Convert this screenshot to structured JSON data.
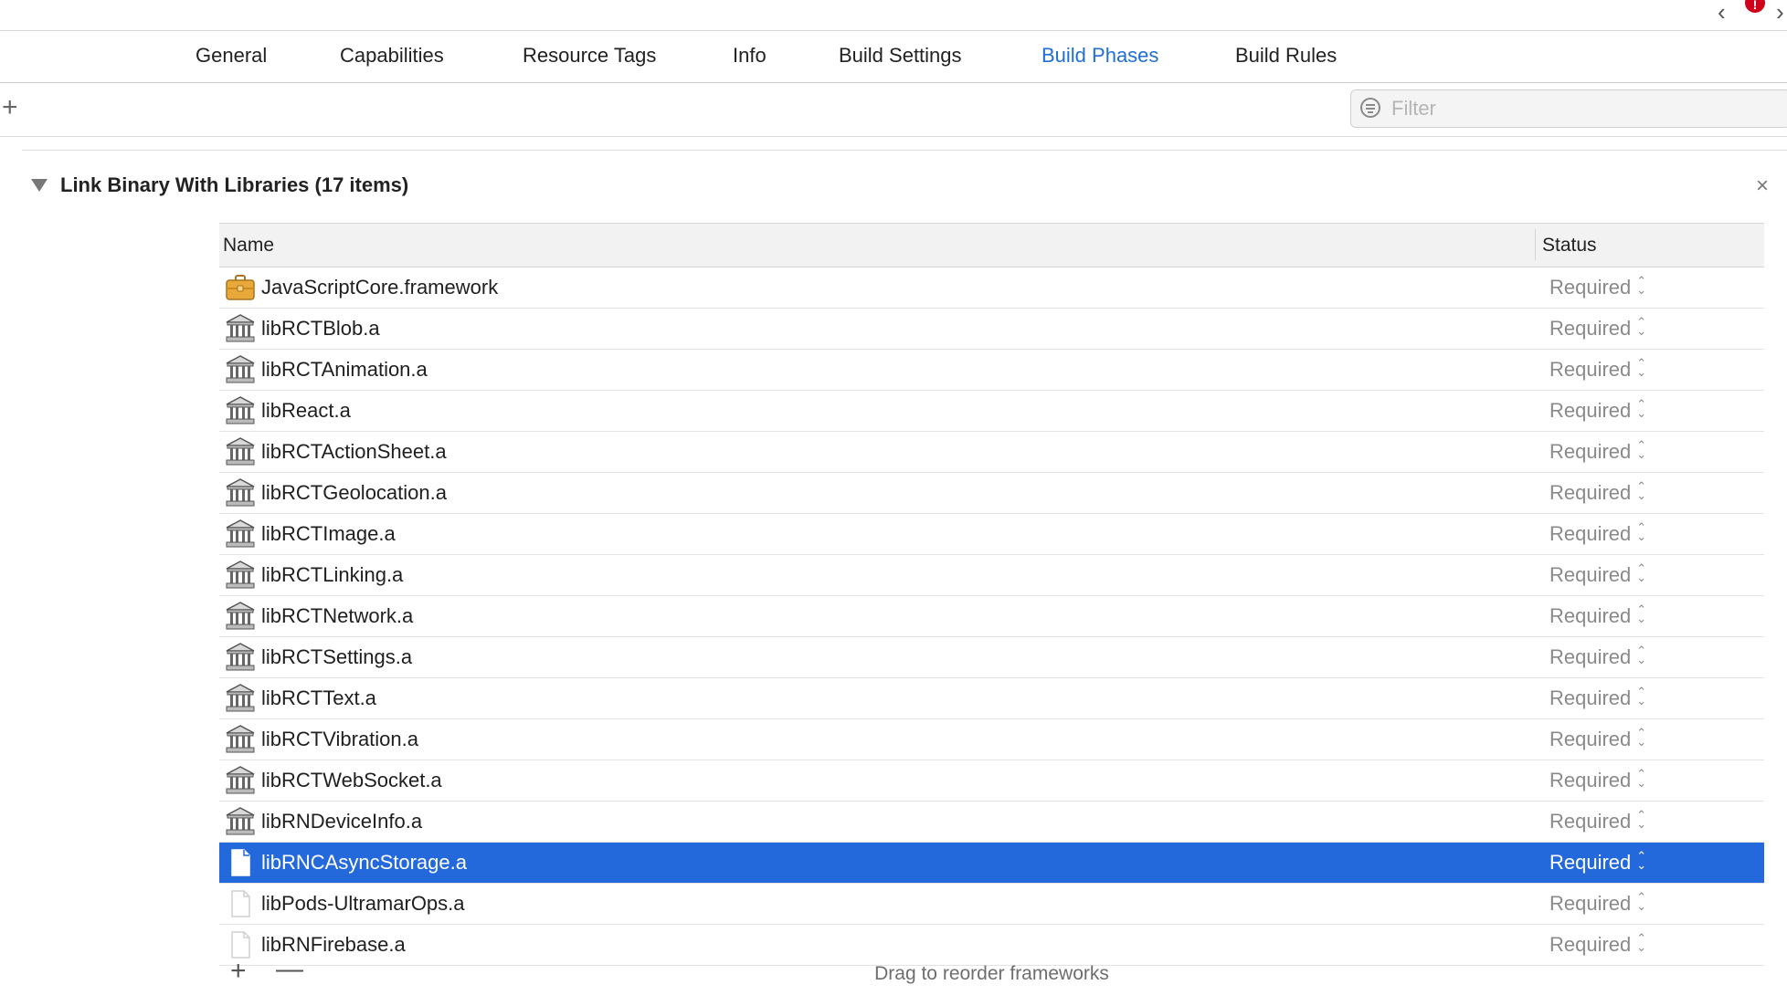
{
  "header": {
    "back_glyph": "‹",
    "forward_glyph": "›",
    "error_badge": "!"
  },
  "tabs": [
    {
      "label": "General"
    },
    {
      "label": "Capabilities"
    },
    {
      "label": "Resource Tags"
    },
    {
      "label": "Info"
    },
    {
      "label": "Build Settings"
    },
    {
      "label": "Build Phases",
      "active": true
    },
    {
      "label": "Build Rules"
    }
  ],
  "toolbar": {
    "add_glyph": "+",
    "filter_placeholder": "Filter",
    "filter_value": ""
  },
  "phase": {
    "title": "Link Binary With Libraries (17 items)",
    "close_glyph": "×"
  },
  "table": {
    "headers": {
      "name": "Name",
      "status": "Status"
    },
    "rows": [
      {
        "name": "JavaScriptCore.framework",
        "status": "Required",
        "icon": "framework-toolbox-icon"
      },
      {
        "name": "libRCTBlob.a",
        "status": "Required",
        "icon": "library-building-icon"
      },
      {
        "name": "libRCTAnimation.a",
        "status": "Required",
        "icon": "library-building-icon"
      },
      {
        "name": "libReact.a",
        "status": "Required",
        "icon": "library-building-icon"
      },
      {
        "name": "libRCTActionSheet.a",
        "status": "Required",
        "icon": "library-building-icon"
      },
      {
        "name": "libRCTGeolocation.a",
        "status": "Required",
        "icon": "library-building-icon"
      },
      {
        "name": "libRCTImage.a",
        "status": "Required",
        "icon": "library-building-icon"
      },
      {
        "name": "libRCTLinking.a",
        "status": "Required",
        "icon": "library-building-icon"
      },
      {
        "name": "libRCTNetwork.a",
        "status": "Required",
        "icon": "library-building-icon"
      },
      {
        "name": "libRCTSettings.a",
        "status": "Required",
        "icon": "library-building-icon"
      },
      {
        "name": "libRCTText.a",
        "status": "Required",
        "icon": "library-building-icon"
      },
      {
        "name": "libRCTVibration.a",
        "status": "Required",
        "icon": "library-building-icon"
      },
      {
        "name": "libRCTWebSocket.a",
        "status": "Required",
        "icon": "library-building-icon"
      },
      {
        "name": "libRNDeviceInfo.a",
        "status": "Required",
        "icon": "library-building-icon"
      },
      {
        "name": "libRNCAsyncStorage.a",
        "status": "Required",
        "icon": "blank-file-icon",
        "selected": true
      },
      {
        "name": "libPods-UltramarOps.a",
        "status": "Required",
        "icon": "blank-file-icon"
      },
      {
        "name": "libRNFirebase.a",
        "status": "Required",
        "icon": "blank-file-icon"
      }
    ]
  },
  "footer": {
    "add_glyph": "+",
    "remove_glyph": "—",
    "hint": "Drag to reorder frameworks"
  },
  "colors": {
    "accent": "#1f6fd6",
    "selection": "#2469dc",
    "framework_icon": "#e8a93a",
    "error": "#d0021b"
  }
}
